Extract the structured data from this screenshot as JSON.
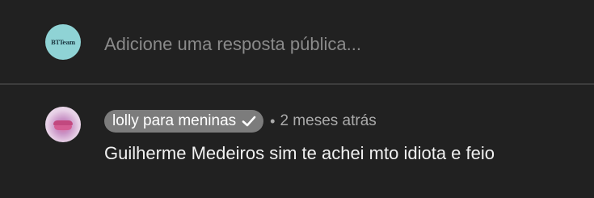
{
  "reply_box": {
    "avatar_logo": "BTTeam",
    "placeholder": "Adicione uma resposta pública..."
  },
  "comment": {
    "author": "lolly para meninas",
    "verified_icon": "checkmark-icon",
    "separator": "•",
    "timestamp": "2 meses atrás",
    "text": "Guilherme Medeiros sim te achei mto idiota e feio"
  },
  "colors": {
    "background": "#212121",
    "chip": "#7c7c7c",
    "avatar_teal": "#8fd3d5"
  }
}
